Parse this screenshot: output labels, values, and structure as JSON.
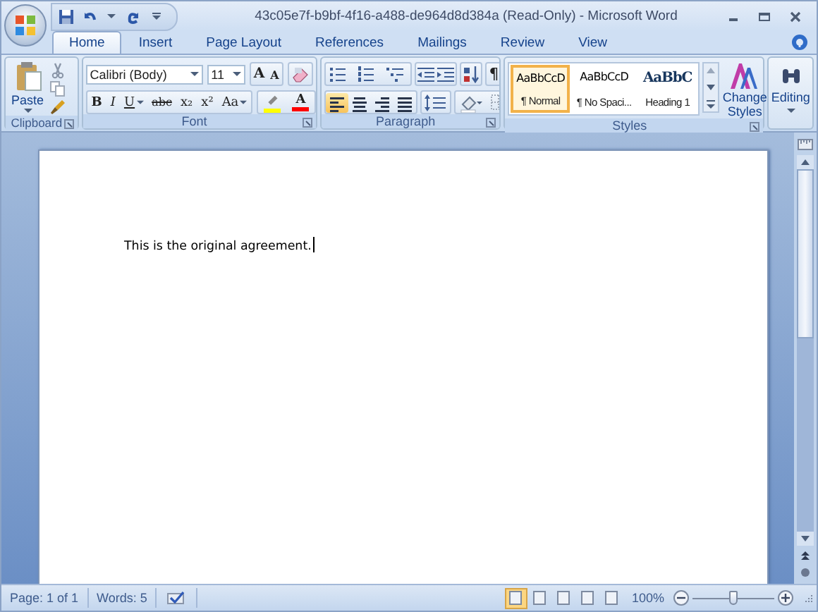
{
  "window": {
    "title": "43c05e7f-b9bf-4f16-a488-de964d8d384a (Read-Only) - Microsoft Word"
  },
  "tabs": [
    {
      "label": "Home",
      "selected": true
    },
    {
      "label": "Insert",
      "selected": false
    },
    {
      "label": "Page Layout",
      "selected": false
    },
    {
      "label": "References",
      "selected": false
    },
    {
      "label": "Mailings",
      "selected": false
    },
    {
      "label": "Review",
      "selected": false
    },
    {
      "label": "View",
      "selected": false
    }
  ],
  "clipboard": {
    "paste_label": "Paste",
    "group_label": "Clipboard"
  },
  "font": {
    "group_label": "Font",
    "font_name": "Calibri (Body)",
    "font_size": "11",
    "grow_label": "A",
    "shrink_label": "A",
    "buttons": [
      {
        "kind": "bold",
        "label": "B",
        "dropdown": false
      },
      {
        "kind": "italic",
        "label": "I",
        "dropdown": false
      },
      {
        "kind": "underline",
        "label": "U",
        "dropdown": true
      },
      {
        "kind": "strike",
        "label": "abc",
        "dropdown": false
      },
      {
        "kind": "plain",
        "label": "x₂",
        "dropdown": false
      },
      {
        "kind": "plain",
        "label": "x²",
        "dropdown": false
      },
      {
        "kind": "plain",
        "label": "Aa",
        "dropdown": true
      }
    ],
    "color_buttons": [
      {
        "kind": "highlight",
        "color": "#ffff00"
      },
      {
        "kind": "font-color",
        "label": "A",
        "color": "#ff0000"
      }
    ]
  },
  "paragraph": {
    "group_label": "Paragraph",
    "pilcrow": "¶",
    "alignments": [
      {
        "selected": true
      },
      {
        "selected": false
      },
      {
        "selected": false
      },
      {
        "selected": false
      }
    ]
  },
  "styles": {
    "group_label": "Styles",
    "change_label": "Change Styles",
    "items": [
      {
        "kind": "normal",
        "preview": "AaBbCcD",
        "name": "¶ Normal",
        "selected": true
      },
      {
        "kind": "normal",
        "preview": "AaBbCcD",
        "name": "¶ No Spaci...",
        "selected": false
      },
      {
        "kind": "heading",
        "preview": "AaBbC",
        "name": "Heading 1",
        "selected": false
      }
    ]
  },
  "editing": {
    "label": "Editing"
  },
  "document": {
    "text": "This is the original agreement."
  },
  "status_bar": {
    "page": "Page: 1 of 1",
    "words": "Words: 5",
    "zoom": "100%",
    "zoom_slider": {
      "level": 0.5
    },
    "views": [
      {
        "selected": true
      },
      {
        "selected": false
      },
      {
        "selected": false
      },
      {
        "selected": false
      },
      {
        "selected": false
      }
    ]
  }
}
